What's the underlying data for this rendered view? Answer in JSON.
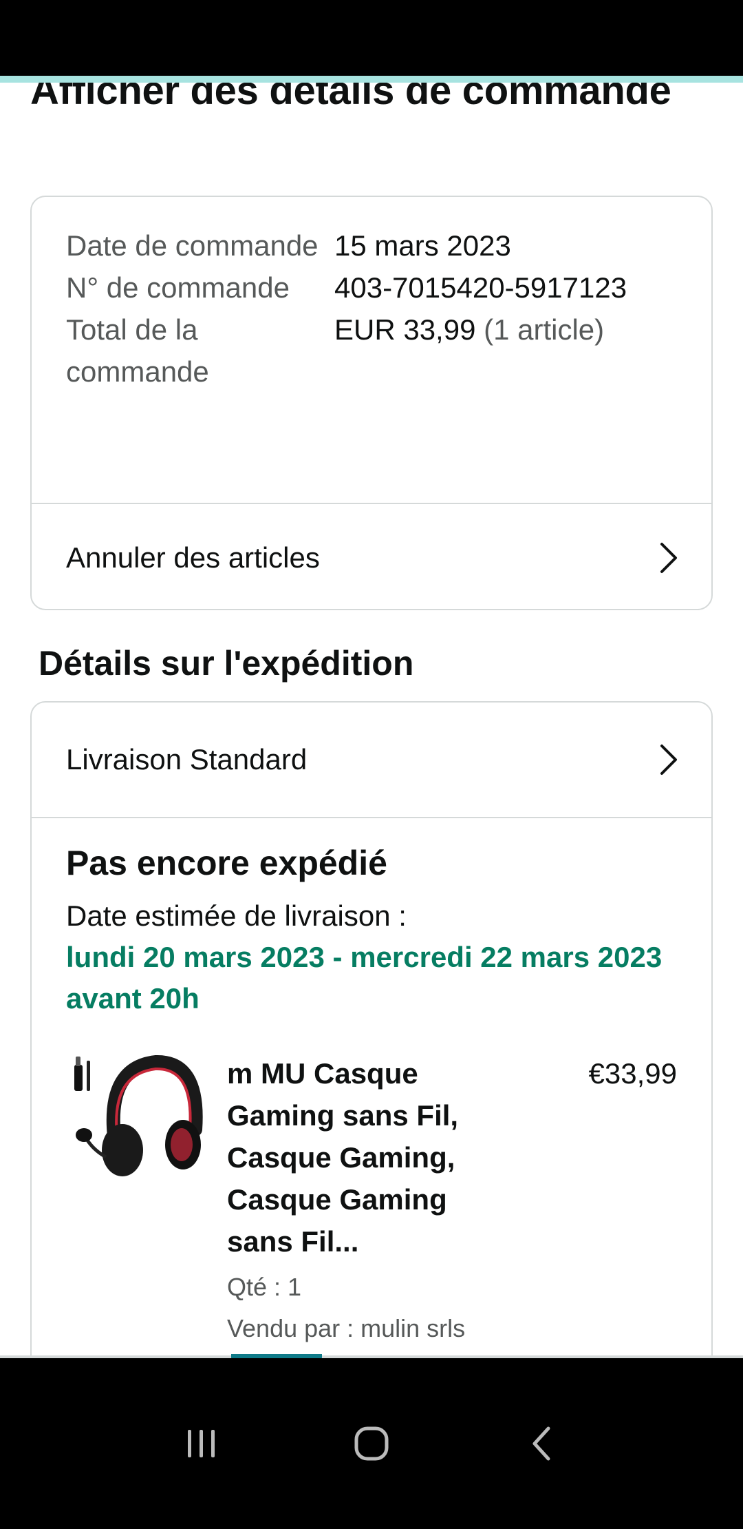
{
  "page": {
    "title": "Afficher des détails de commande"
  },
  "summary": {
    "rows": [
      {
        "label": "Date de commande",
        "value": "15 mars 2023",
        "suffix": ""
      },
      {
        "label": "N° de commande",
        "value": "403-7015420-5917123",
        "suffix": ""
      },
      {
        "label": "Total de la commande",
        "value": "EUR 33,99",
        "suffix": " (1 article)"
      }
    ],
    "cancel_label": "Annuler des articles"
  },
  "shipping": {
    "heading": "Détails sur l'expédition",
    "method": "Livraison Standard",
    "status": "Pas encore expédié",
    "estimate_label": "Date estimée de livraison :",
    "estimate_date": "lundi 20 mars 2023 - mercredi 22 mars 2023 avant 20h"
  },
  "product": {
    "title": "m MU Casque Gaming sans Fil, Casque Gaming, Casque Gaming sans Fil...",
    "price": "€33,99",
    "qty": "Qté : 1",
    "seller": "Vendu par : mulin srls",
    "image_icon": "headset-image"
  },
  "colors": {
    "accent_green": "#067d62",
    "border": "#d5d9d9",
    "muted_text": "#565959",
    "scroll_thumb": "#0f7b89",
    "top_accent": "#a7e3e0"
  },
  "nav": {
    "icons": [
      "recent-apps-icon",
      "home-icon",
      "back-icon"
    ]
  }
}
